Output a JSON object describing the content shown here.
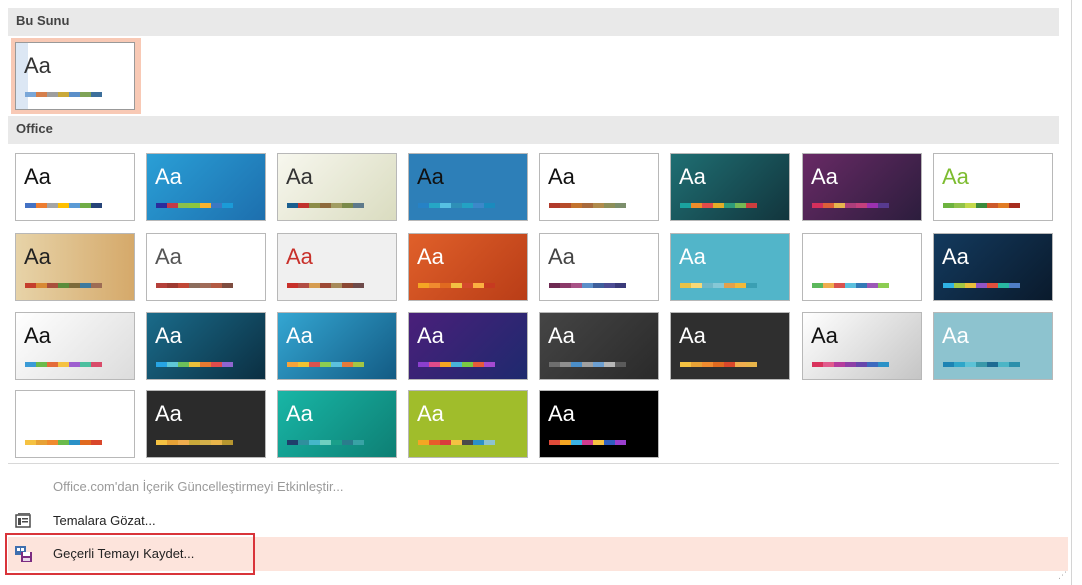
{
  "sections": {
    "current": "Bu Sunu",
    "office": "Office"
  },
  "aa": "Aa",
  "themes": {
    "current": {
      "name": "current-theme",
      "bg": "#ffffff",
      "aa_color": "#333333",
      "swatches": [
        "#7aa7d8",
        "#d57f4c",
        "#9e9e9e",
        "#c9a93a",
        "#5b8fc9",
        "#7fa357",
        "#3d6f9b"
      ]
    },
    "office": [
      {
        "name": "office-theme",
        "bg": "#ffffff",
        "aa_color": "#111111",
        "swatches": [
          "#4472c4",
          "#ed7d31",
          "#a5a5a5",
          "#ffc000",
          "#5b9bd5",
          "#70ad47",
          "#264478"
        ]
      },
      {
        "name": "facet-theme",
        "bg": "linear-gradient(135deg,#2a9fd6,#1d6fae)",
        "aa_color": "#ffffff",
        "swatches": [
          "#2b2b9c",
          "#c33a48",
          "#8bc04a",
          "#8cc63f",
          "#f8b32d",
          "#3b78c3",
          "#1b9bd7"
        ]
      },
      {
        "name": "integral-theme",
        "bg": "linear-gradient(135deg,#f7f7ee,#dadcc0)",
        "aa_color": "#333333",
        "swatches": [
          "#1b5f8f",
          "#c1322c",
          "#8c8c47",
          "#8e6a3c",
          "#a19d62",
          "#7a8a4a",
          "#5e7a8b"
        ]
      },
      {
        "name": "ion-theme",
        "bg": "#2d7fb8",
        "aa_color": "#111111",
        "swatches": [
          "#2682c6",
          "#25a6c6",
          "#56c0e3",
          "#2e8fb7",
          "#23a2c4",
          "#3c88c9",
          "#1a8bbd"
        ]
      },
      {
        "name": "ion-boardroom-theme",
        "bg": "#ffffff",
        "aa_color": "#111111",
        "swatches": [
          "#b13a2b",
          "#b64b2a",
          "#c3732d",
          "#a86a3c",
          "#b08b4c",
          "#8d8f59",
          "#7c8f6c"
        ]
      },
      {
        "name": "organic-theme",
        "bg": "linear-gradient(135deg,#1f6f73,#12353d)",
        "aa_color": "#ffffff",
        "swatches": [
          "#1aa39f",
          "#ee8c2a",
          "#e24b4a",
          "#e4ac27",
          "#2e9b7b",
          "#76b854",
          "#cc3e3e"
        ]
      },
      {
        "name": "retrospect-theme",
        "bg": "linear-gradient(135deg,#682a65,#2c1d3d)",
        "aa_color": "#ffffff",
        "swatches": [
          "#d42f5c",
          "#de5f39",
          "#e6b64e",
          "#ac3e7b",
          "#c3407c",
          "#9c31b0",
          "#573a8f"
        ]
      },
      {
        "name": "slice-theme",
        "bg": "#ffffff",
        "aa_color": "#7dbc30",
        "swatches": [
          "#6db33f",
          "#91c24a",
          "#c3d94b",
          "#3b8a3b",
          "#cc5a2b",
          "#e17c24",
          "#a72d1f"
        ]
      },
      {
        "name": "wisp-theme",
        "bg": "linear-gradient(90deg,#e7d3a8,#d5a96a)",
        "aa_color": "#222222",
        "swatches": [
          "#c53e2d",
          "#d88934",
          "#a94f3c",
          "#5b8c3b",
          "#7c6a3a",
          "#3d7a9e",
          "#9d6c54"
        ]
      },
      {
        "name": "gallery-theme",
        "bg": "#ffffff",
        "aa_color": "#555555",
        "swatches": [
          "#b5403a",
          "#9e3a31",
          "#c14736",
          "#8c6d5d",
          "#a06b58",
          "#b35a43",
          "#7e4d40"
        ]
      },
      {
        "name": "berlin-theme",
        "bg": "#f0f0f0",
        "aa_color": "#c8302a",
        "swatches": [
          "#c8302a",
          "#b24d43",
          "#d69c50",
          "#9c4935",
          "#a78a5a",
          "#8b4733",
          "#6e4b4b"
        ]
      },
      {
        "name": "main-event-theme",
        "bg": "linear-gradient(135deg,#e0602a,#b93d17)",
        "aa_color": "#ffffff",
        "swatches": [
          "#f5a623",
          "#f08b2f",
          "#e06a20",
          "#f2c142",
          "#d3492c",
          "#fbb040",
          "#c73a20"
        ]
      },
      {
        "name": "mesh-theme",
        "bg": "#ffffff",
        "aa_color": "#444444",
        "swatches": [
          "#6e2a52",
          "#8b3a69",
          "#a85286",
          "#5b8fc9",
          "#3e5f9c",
          "#4d4d94",
          "#3b3b7a"
        ]
      },
      {
        "name": "savon-theme",
        "bg": "#52b5c9",
        "aa_color": "#ffffff",
        "swatches": [
          "#e6c245",
          "#f7d976",
          "#6fb8c9",
          "#86c8d6",
          "#e2a14c",
          "#f2b93a",
          "#3a9fb3"
        ]
      },
      {
        "name": "view-theme",
        "bg": "#ffffff",
        "aa_color": "#ffffff",
        "swatches": [
          "#5cb85c",
          "#f0ad4e",
          "#d9534f",
          "#5bc0de",
          "#337ab7",
          "#9b59b6",
          "#8ccd52"
        ]
      },
      {
        "name": "dividend-theme",
        "bg": "linear-gradient(135deg,#133a5e,#0a1a2c)",
        "aa_color": "#ffffff",
        "swatches": [
          "#2fb2e4",
          "#a3c644",
          "#e9be3a",
          "#9155c6",
          "#e0503d",
          "#28b7a2",
          "#4f7ec7"
        ]
      },
      {
        "name": "circuit-theme",
        "bg": "linear-gradient(135deg,#ffffff,#dcdcdc)",
        "aa_color": "#111111",
        "swatches": [
          "#3b9bd6",
          "#6bba4b",
          "#e46c3a",
          "#f5c242",
          "#9e5fcf",
          "#4cbf9f",
          "#d94c6a"
        ]
      },
      {
        "name": "droplet-theme",
        "bg": "linear-gradient(135deg,#1a6b8a,#0b2f42)",
        "aa_color": "#ffffff",
        "swatches": [
          "#27a4e4",
          "#5fc6d6",
          "#6cbf5a",
          "#e9c03a",
          "#e77a31",
          "#df4c4c",
          "#9065cf"
        ]
      },
      {
        "name": "frame-theme",
        "bg": "linear-gradient(135deg,#34a6d2,#135b84)",
        "aa_color": "#ffffff",
        "swatches": [
          "#f6a33a",
          "#f1c232",
          "#d9534f",
          "#8ccd52",
          "#5bc0de",
          "#e57a3a",
          "#a3c644"
        ]
      },
      {
        "name": "metropolitan-theme",
        "bg": "linear-gradient(135deg,#4a1f7a,#1e2a6e)",
        "aa_color": "#ffffff",
        "swatches": [
          "#8b3fce",
          "#e04b8a",
          "#f5a623",
          "#49b3d8",
          "#7ac943",
          "#e65b3a",
          "#a54ad0"
        ]
      },
      {
        "name": "parallax-theme",
        "bg": "linear-gradient(135deg,#454545,#2a2a2a)",
        "aa_color": "#ffffff",
        "swatches": [
          "#6e6e6e",
          "#8f8f8f",
          "#4b8ec8",
          "#a0a0a0",
          "#6c9fd1",
          "#b7b7b7",
          "#5b5b5b"
        ]
      },
      {
        "name": "quotable-theme",
        "bg": "#2f2f2f",
        "aa_color": "#ffffff",
        "swatches": [
          "#f5c242",
          "#e7a236",
          "#f08b2f",
          "#e06a20",
          "#d9472b",
          "#f0ad4e",
          "#e8b44a"
        ]
      },
      {
        "name": "basis-theme",
        "bg": "linear-gradient(135deg,#ffffff,#c5c5c5)",
        "aa_color": "#111111",
        "swatches": [
          "#d9335c",
          "#e15b8d",
          "#b53c9c",
          "#8e3fa6",
          "#6747ac",
          "#3d6abf",
          "#2b91c7"
        ]
      },
      {
        "name": "dividend-blue-theme",
        "bg": "#8dc3cf",
        "aa_color": "#ffffff",
        "swatches": [
          "#1d83b3",
          "#2fa6c9",
          "#5cc2d6",
          "#3898a9",
          "#1e6b93",
          "#4bb5c6",
          "#2b8fab"
        ]
      },
      {
        "name": "badge-theme",
        "bg": "#ffffff",
        "aa_color": "#ffffff",
        "swatches": [
          "#f5c242",
          "#e7a236",
          "#f08b2f",
          "#6bba4b",
          "#2b91c7",
          "#e06a20",
          "#d9472b"
        ]
      },
      {
        "name": "vapor-trail-theme",
        "bg": "#2b2b2b",
        "aa_color": "#ffffff",
        "swatches": [
          "#f5c242",
          "#e7a236",
          "#f0ad4e",
          "#c9a93a",
          "#d4b04a",
          "#e8b44a",
          "#b7962f"
        ]
      },
      {
        "name": "feathered-theme",
        "bg": "linear-gradient(135deg,#18b6a6,#0e7f74)",
        "aa_color": "#ffffff",
        "swatches": [
          "#1f3f6b",
          "#2f8f9d",
          "#45b7c9",
          "#6fd0c0",
          "#1a9f8a",
          "#2a7c8c",
          "#38a3a5"
        ]
      },
      {
        "name": "headlines-theme",
        "bg": "#a0bd2b",
        "aa_color": "#ffffff",
        "swatches": [
          "#f5a623",
          "#e95c2a",
          "#d93c3c",
          "#f5c242",
          "#4a4a4a",
          "#2b91c7",
          "#8dc3cf"
        ]
      },
      {
        "name": "celestial-theme",
        "bg": "#000000",
        "aa_color": "#ffffff",
        "swatches": [
          "#e04b3a",
          "#f5a623",
          "#3bb3e4",
          "#cf3b8f",
          "#f5c242",
          "#2f5fbf",
          "#9a3fce"
        ]
      }
    ]
  },
  "menu": {
    "enable_updates": "Office.com'dan İçerik Güncelleştirmeyi Etkinleştir...",
    "browse_themes": "Temalara Gözat...",
    "save_current_theme": "Geçerli Temayı Kaydet..."
  },
  "colors": {
    "highlight": "#fde4dc",
    "selection_box": "#d9343a",
    "current_bg": "#f8c9b5"
  }
}
